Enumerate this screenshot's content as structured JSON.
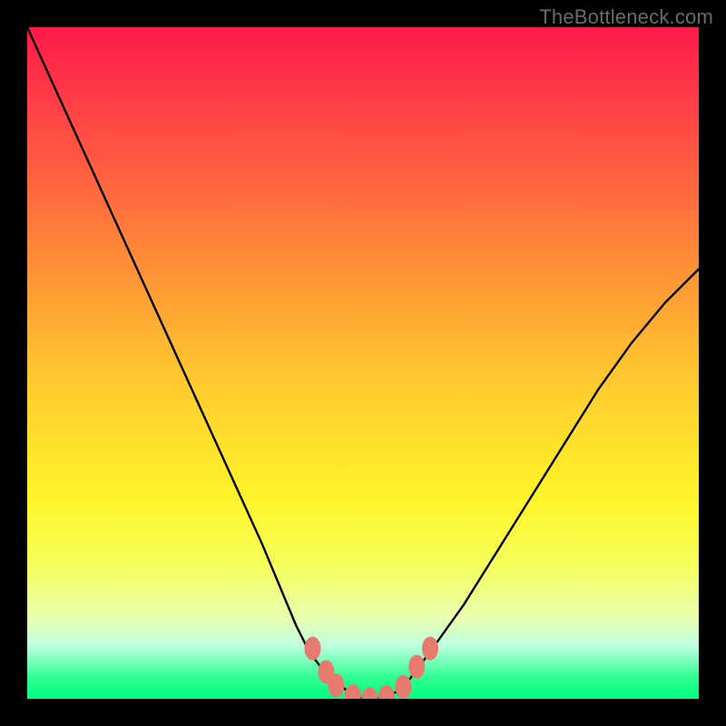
{
  "watermark": "TheBottleneck.com",
  "colors": {
    "background": "#000000",
    "gradient_top": "#ff1a4a",
    "gradient_bottom": "#00ff82",
    "curve": "#000000",
    "marker": "#e77a6f"
  },
  "chart_data": {
    "type": "line",
    "title": "",
    "xlabel": "",
    "ylabel": "",
    "xlim": [
      0,
      100
    ],
    "ylim": [
      0,
      100
    ],
    "grid": false,
    "legend": false,
    "series": [
      {
        "name": "bottleneck-curve",
        "x": [
          0,
          5,
          10,
          15,
          20,
          25,
          30,
          35,
          40,
          42,
          45,
          48,
          50,
          52,
          55,
          57,
          60,
          65,
          70,
          75,
          80,
          85,
          90,
          95,
          100
        ],
        "y": [
          100,
          89,
          78,
          67,
          56,
          45,
          34,
          23,
          11,
          7,
          3,
          1,
          0,
          0,
          1,
          3,
          7,
          14,
          22,
          30,
          38,
          46,
          53,
          59,
          64
        ]
      }
    ],
    "markers": [
      {
        "x": 42.5,
        "y": 7.5
      },
      {
        "x": 44.5,
        "y": 4.0
      },
      {
        "x": 46.0,
        "y": 2.0
      },
      {
        "x": 48.5,
        "y": 0.4
      },
      {
        "x": 51.0,
        "y": 0.0
      },
      {
        "x": 53.5,
        "y": 0.3
      },
      {
        "x": 56.0,
        "y": 1.8
      },
      {
        "x": 58.0,
        "y": 4.8
      },
      {
        "x": 60.0,
        "y": 7.5
      }
    ]
  }
}
